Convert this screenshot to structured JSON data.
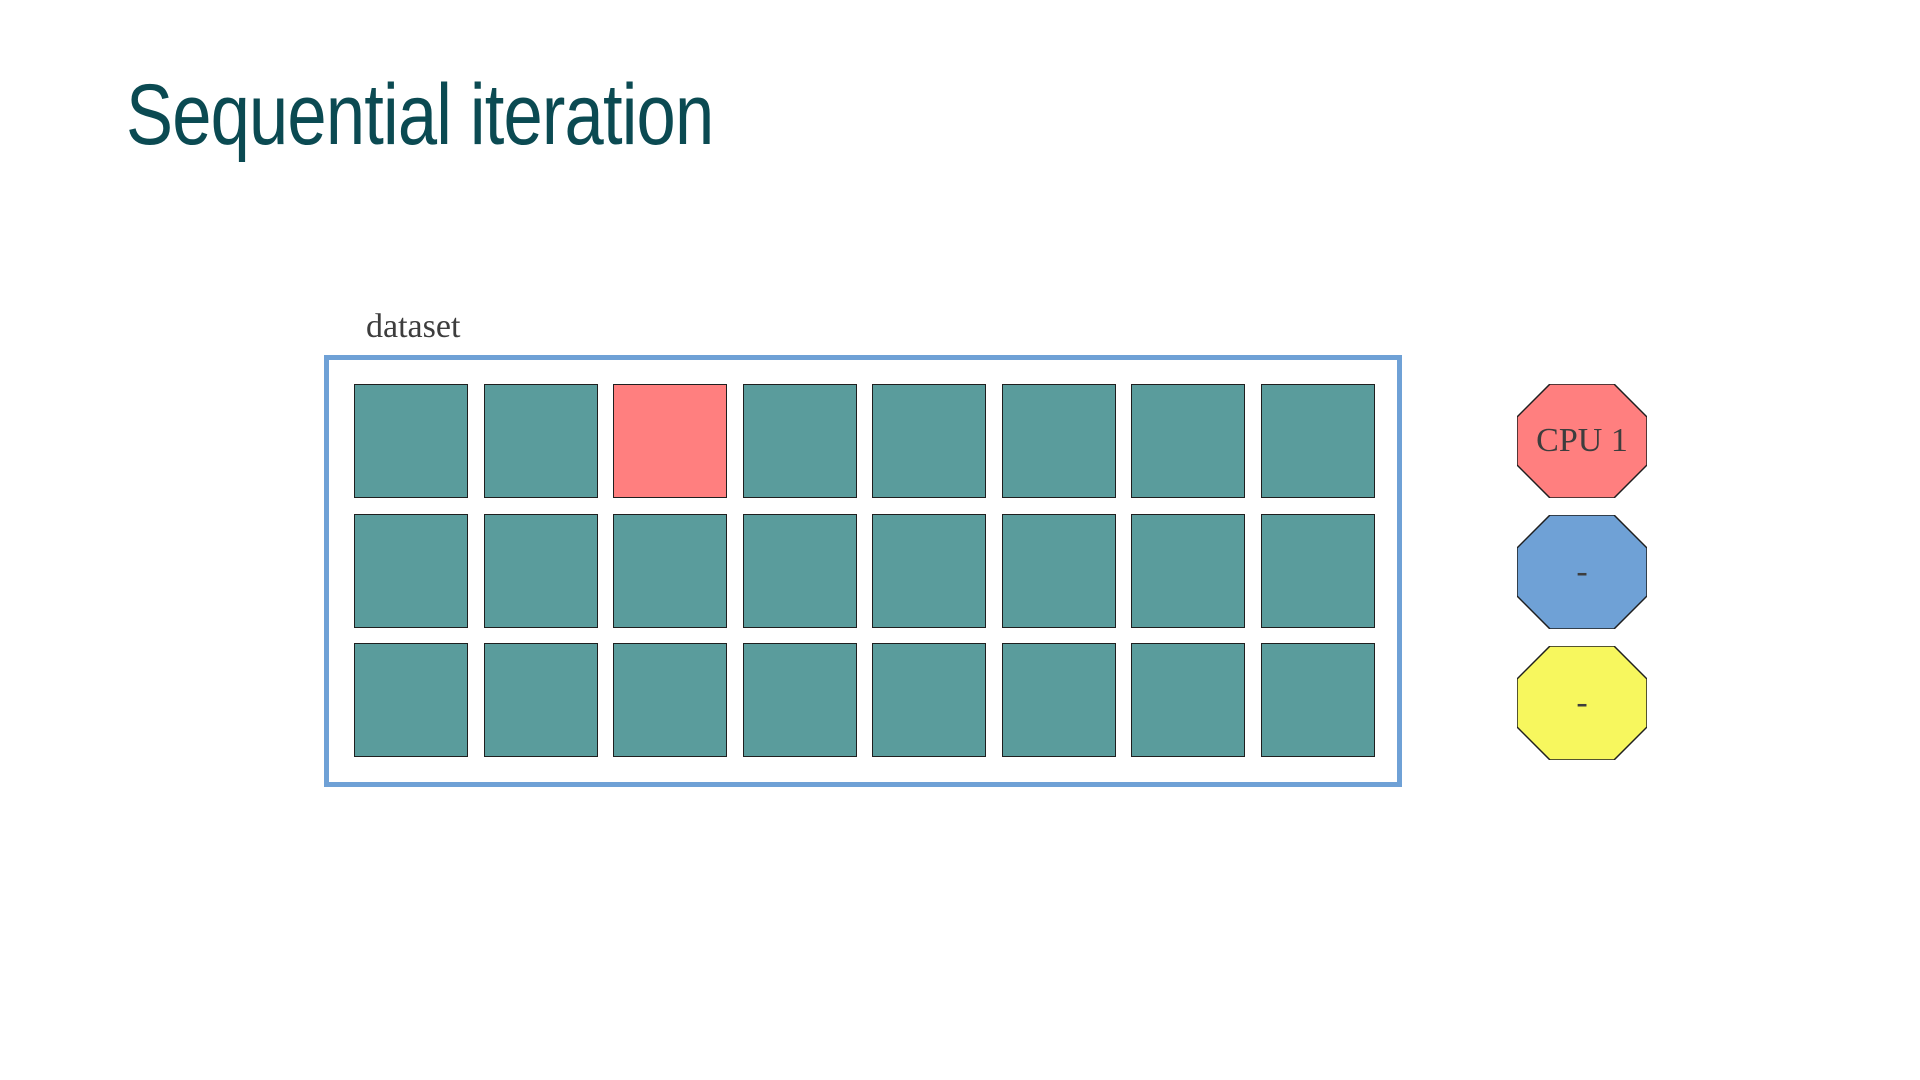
{
  "title": "Sequential iteration",
  "dataset": {
    "label": "dataset",
    "rows": 3,
    "cols": 8,
    "cell_color": "#5a9c9c",
    "active_cell_color": "#ff7f7f",
    "border_color": "#6fa1d6",
    "active_cells": [
      [
        0,
        2
      ]
    ]
  },
  "cpus": [
    {
      "label": "CPU 1",
      "color": "#ff7f7f"
    },
    {
      "label": "-",
      "color": "#6fa1d6"
    },
    {
      "label": "-",
      "color": "#f7f75e"
    }
  ]
}
